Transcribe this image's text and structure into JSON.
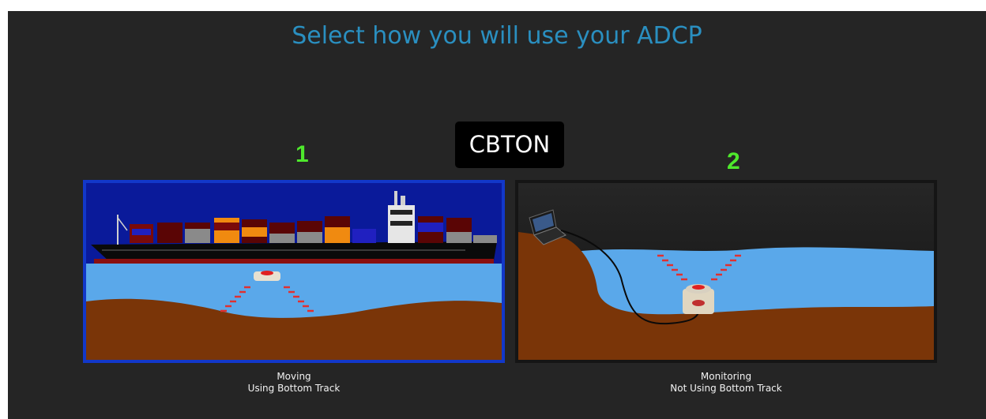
{
  "title": "Select how you will use your ADCP",
  "mode_badge": "CBTON",
  "options": [
    {
      "number": "1",
      "caption_line1": "Moving",
      "caption_line2": "Using Bottom Track"
    },
    {
      "number": "2",
      "caption_line1": "Monitoring",
      "caption_line2": "Not Using Bottom Track"
    }
  ],
  "colors": {
    "background": "#252525",
    "title": "#2a8fc0",
    "number": "#4ee82c",
    "selected_border": "#1238c9",
    "water": "#5aa8ea",
    "seabed": "#7a3508"
  }
}
